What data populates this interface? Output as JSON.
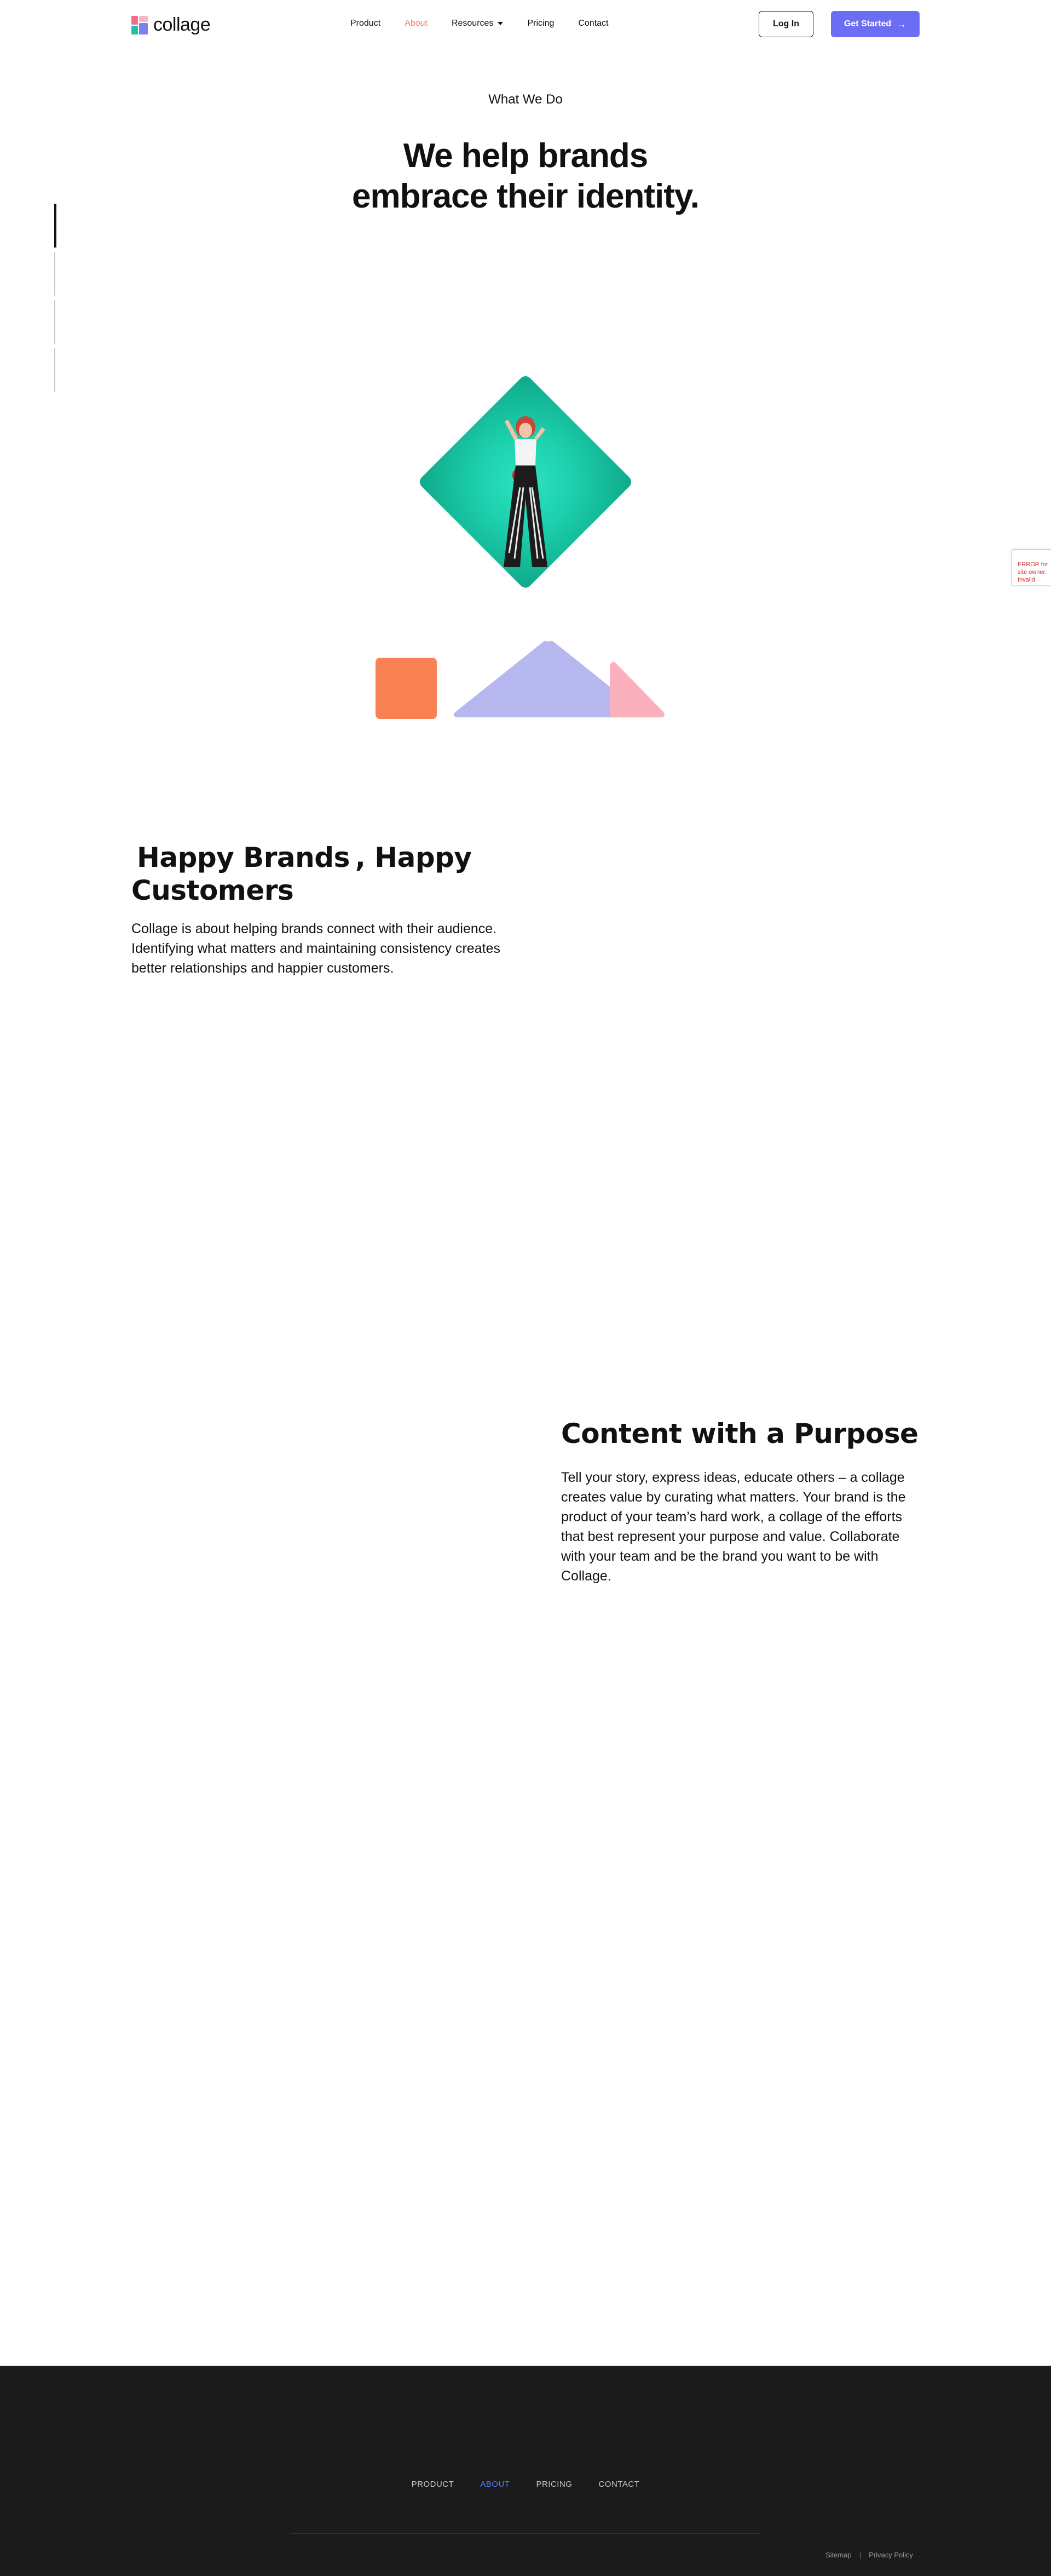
{
  "brand": {
    "name": "collage"
  },
  "nav": {
    "items": [
      {
        "label": "Product",
        "active": false
      },
      {
        "label": "About",
        "active": true
      },
      {
        "label": "Resources",
        "active": false,
        "has_dropdown": true
      },
      {
        "label": "Pricing",
        "active": false
      },
      {
        "label": "Contact",
        "active": false
      }
    ],
    "login_label": "Log In",
    "start_label": "Get Started"
  },
  "side_progress": {
    "count": 4,
    "active_index": 0
  },
  "hero": {
    "eyebrow": "What We Do",
    "title_line1": "We help brands",
    "title_line2": "embrace their identity."
  },
  "section1": {
    "title_highlight": "Happy Brands",
    "title_rest": ", Happy Customers",
    "body": "Collage is about helping brands connect with their audience. Identifying what matters and maintaining consistency creates better relationships and happier customers."
  },
  "section2": {
    "title": "Content with a Purpose",
    "body": "Tell your story, express ideas, educate others – a collage creates value by curating what matters. Your brand is the product of your team’s hard work, a collage of the efforts that best represent your purpose and value. Collaborate with your team and be the brand you want to be with Collage."
  },
  "recaptcha": {
    "text": "ERROR for site owner: Invalid domain for site key"
  },
  "footer": {
    "links": [
      {
        "label": "PRODUCT",
        "active": false
      },
      {
        "label": "ABOUT",
        "active": true
      },
      {
        "label": "PRICING",
        "active": false
      },
      {
        "label": "CONTACT",
        "active": false
      }
    ],
    "sitemap": "Sitemap",
    "separator": "|",
    "privacy": "Privacy Policy"
  },
  "colors": {
    "accent": "#6b6ef5",
    "nav_active": "#f27a63",
    "highlight": "#c9c8f2",
    "teal": "#1ccfad",
    "orange": "#f98255",
    "lavender": "#b8b8f0",
    "pink": "#fbb0bd",
    "footer_bg": "#1b1b1b",
    "footer_active": "#4e7cf7"
  }
}
